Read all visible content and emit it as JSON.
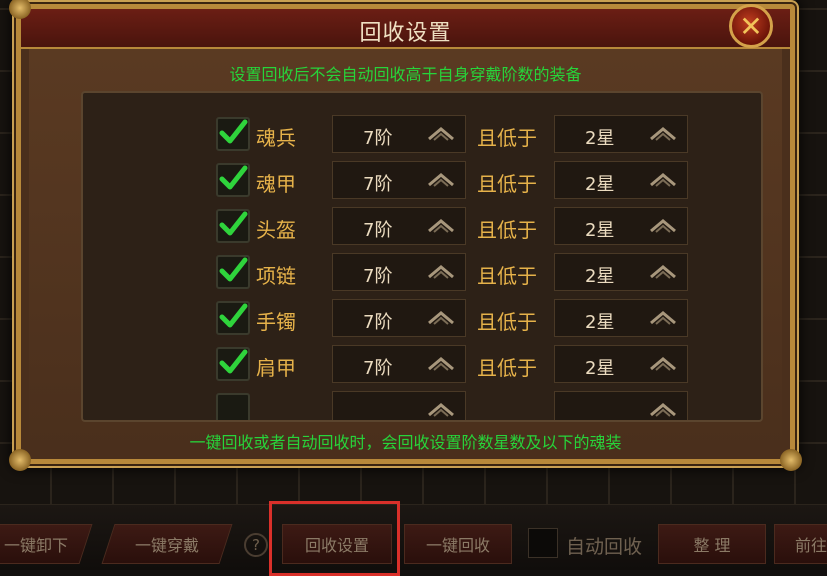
{
  "dialog": {
    "title": "回收设置",
    "info_top": "设置回收后不会自动回收高于自身穿戴阶数的装备",
    "info_bottom": "一键回收或者自动回收时，会回收设置阶数星数及以下的魂装",
    "and_label": "且低于",
    "rows": [
      {
        "slot": "魂兵",
        "checked": true,
        "tier": "7阶",
        "star": "2星"
      },
      {
        "slot": "魂甲",
        "checked": true,
        "tier": "7阶",
        "star": "2星"
      },
      {
        "slot": "头盔",
        "checked": true,
        "tier": "7阶",
        "star": "2星"
      },
      {
        "slot": "项链",
        "checked": true,
        "tier": "7阶",
        "star": "2星"
      },
      {
        "slot": "手镯",
        "checked": true,
        "tier": "7阶",
        "star": "2星"
      },
      {
        "slot": "肩甲",
        "checked": true,
        "tier": "7阶",
        "star": "2星"
      }
    ]
  },
  "bottom_bar": {
    "unequip_all": "一键卸下",
    "equip_all": "一键穿戴",
    "help": "?",
    "recycle_settings": "回收设置",
    "recycle_all": "一键回收",
    "auto_recycle": "自动回收",
    "sort": "整 理",
    "goto": "前往"
  },
  "colors": {
    "gold": "#e6b24a",
    "green_text": "#27d43a",
    "highlight": "#d9302a"
  }
}
